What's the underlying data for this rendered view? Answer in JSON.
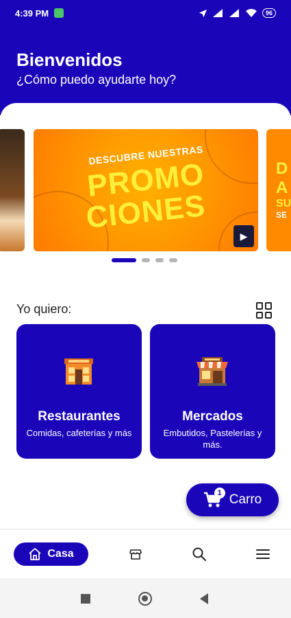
{
  "status_bar": {
    "time": "4:39 PM",
    "battery": "96"
  },
  "header": {
    "title": "Bienvenidos",
    "subtitle": "¿Cómo puedo ayudarte hoy?"
  },
  "carousel": {
    "promo": {
      "line1": "DESCUBRE NUESTRAS",
      "line2": "PROMO",
      "line3": "CIONES"
    },
    "next_peek": [
      "D",
      "A",
      "SU",
      "SE"
    ],
    "active_index": 0,
    "slide_count": 4
  },
  "section": {
    "label": "Yo quiero:"
  },
  "categories": [
    {
      "title": "Restaurantes",
      "description": "Comidas, cafeterías y más",
      "icon": "restaurant-store-icon"
    },
    {
      "title": "Mercados",
      "description": "Embutidos, Pastelerías y más.",
      "icon": "market-store-icon"
    }
  ],
  "cart": {
    "label": "Carro",
    "count": "1"
  },
  "bottom_nav": {
    "home_label": "Casa",
    "items": [
      "home-icon",
      "store-icon",
      "search-icon",
      "menu-icon"
    ]
  },
  "colors": {
    "primary": "#1a06b8",
    "promo_orange": "#ff9a00",
    "promo_yellow": "#ffef3a"
  }
}
